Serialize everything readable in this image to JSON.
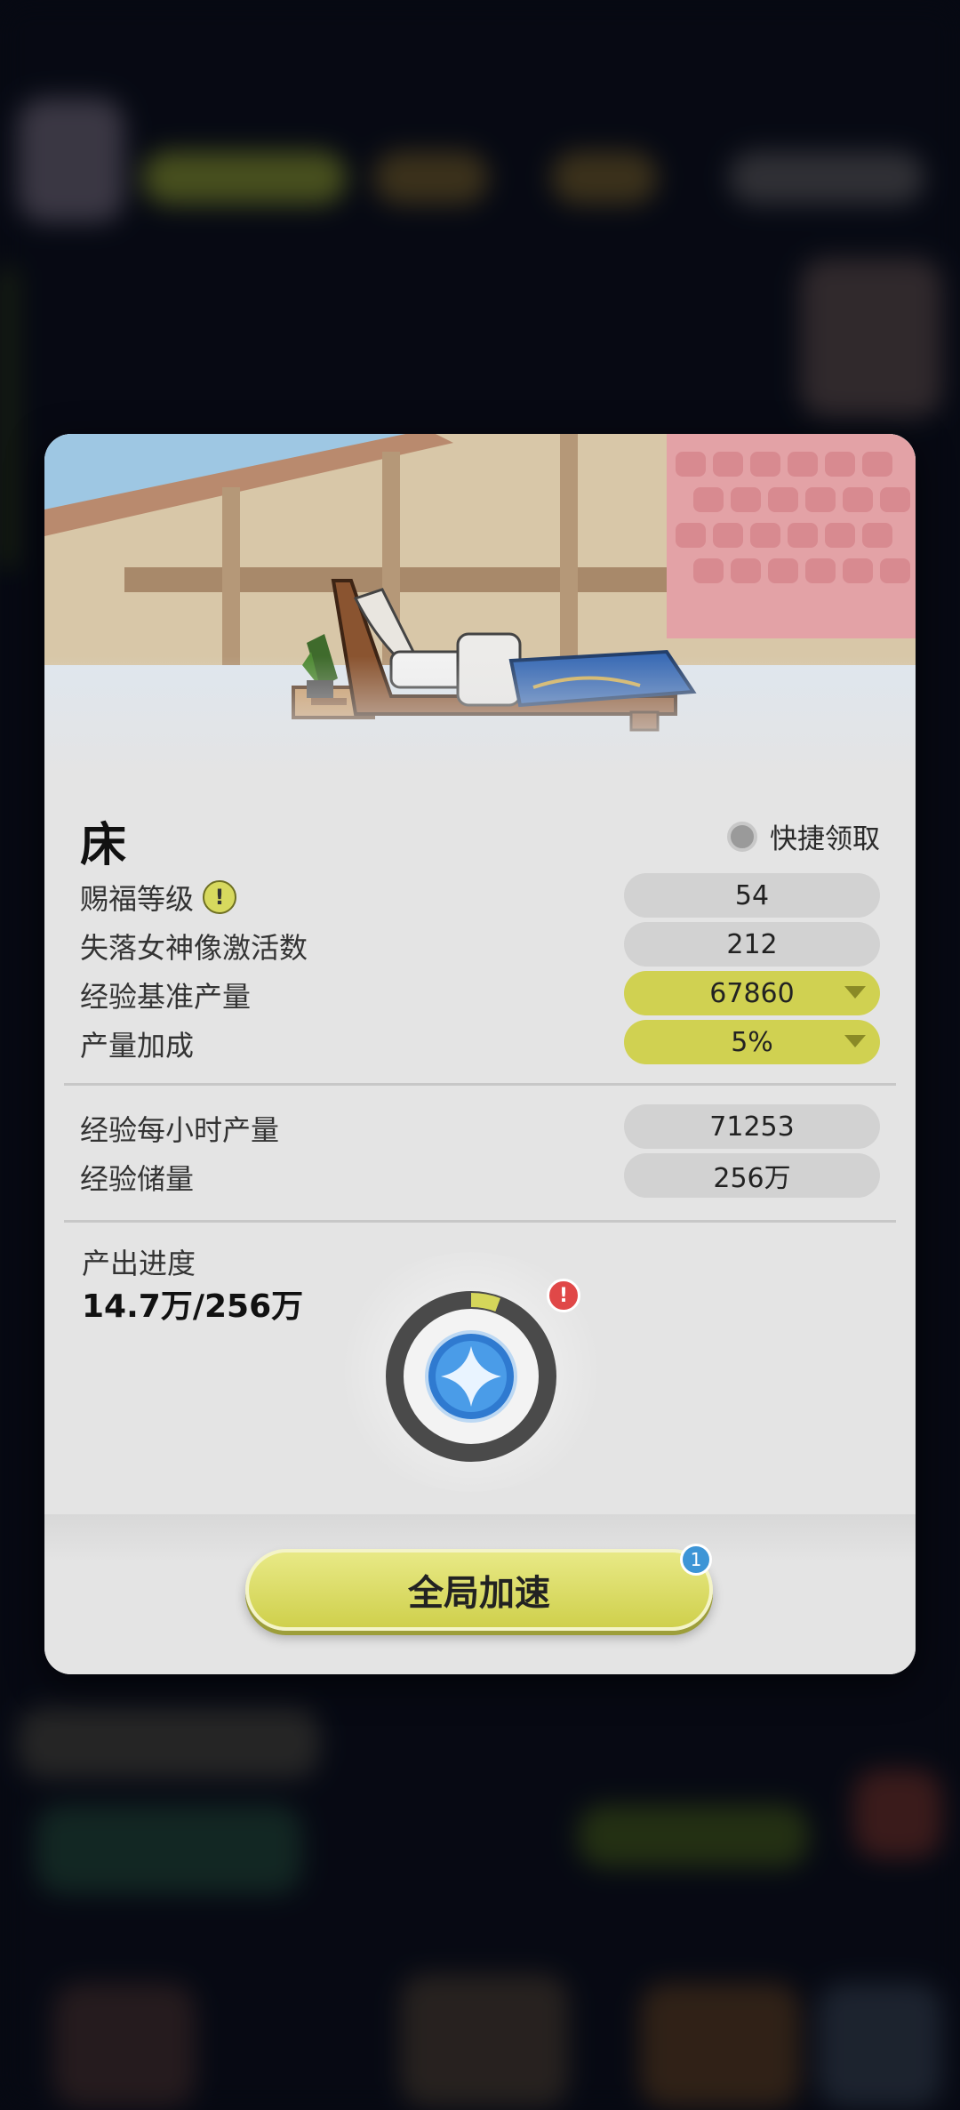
{
  "building": {
    "name": "床",
    "quick_claim_label": "快捷领取"
  },
  "stats_primary": [
    {
      "label": "赐福等级",
      "value": "54",
      "style": "gray",
      "has_info": true,
      "has_dropdown": false
    },
    {
      "label": "失落女神像激活数",
      "value": "212",
      "style": "gray",
      "has_info": false,
      "has_dropdown": false
    },
    {
      "label": "经验基准产量",
      "value": "67860",
      "style": "yellow",
      "has_info": false,
      "has_dropdown": true
    },
    {
      "label": "产量加成",
      "value": "5%",
      "style": "yellow",
      "has_info": false,
      "has_dropdown": true
    }
  ],
  "stats_secondary": [
    {
      "label": "经验每小时产量",
      "value": "71253"
    },
    {
      "label": "经验储量",
      "value": "256万"
    }
  ],
  "progress": {
    "label": "产出进度",
    "value_text": "14.7万/256万",
    "fraction": 0.057
  },
  "action": {
    "accelerate_label": "全局加速",
    "badge_count": "1"
  },
  "colors": {
    "accent_yellow": "#d0d151",
    "panel_bg": "#e4e4e4",
    "pill_gray": "#d2d2d2",
    "alert_red": "#e04848",
    "badge_blue": "#3d95d6"
  },
  "icons": {
    "info": "exclamation-info-icon",
    "alert": "exclamation-alert-icon",
    "orb": "blue-star-orb-icon",
    "dropdown": "caret-down-icon"
  }
}
